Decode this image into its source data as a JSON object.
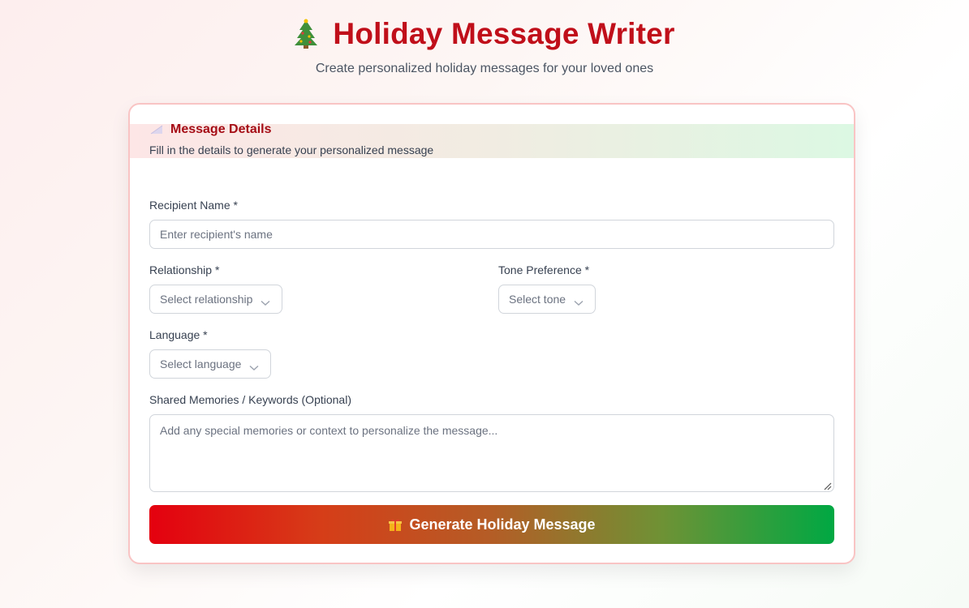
{
  "header": {
    "title": "Holiday Message Writer",
    "subtitle": "Create personalized holiday messages for your loved ones",
    "icon": "christmas-tree-icon"
  },
  "card": {
    "title": "Message Details",
    "description": "Fill in the details to generate your personalized message",
    "icon": "memo-icon"
  },
  "form": {
    "recipient": {
      "label": "Recipient Name *",
      "placeholder": "Enter recipient's name"
    },
    "relationship": {
      "label": "Relationship *",
      "value": "Select relationship"
    },
    "tone": {
      "label": "Tone Preference *",
      "value": "Select tone"
    },
    "language": {
      "label": "Language *",
      "value": "Select language"
    },
    "memories": {
      "label": "Shared Memories / Keywords (Optional)",
      "placeholder": "Add any special memories or context to personalize the message..."
    }
  },
  "generate_button": {
    "label": "Generate Holiday Message",
    "icon": "gift-icon"
  },
  "colors": {
    "title": "#c00f1a",
    "card_border": "#f9c4c4",
    "button_gradient_start": "#e4000f",
    "button_gradient_end": "#00a843"
  }
}
